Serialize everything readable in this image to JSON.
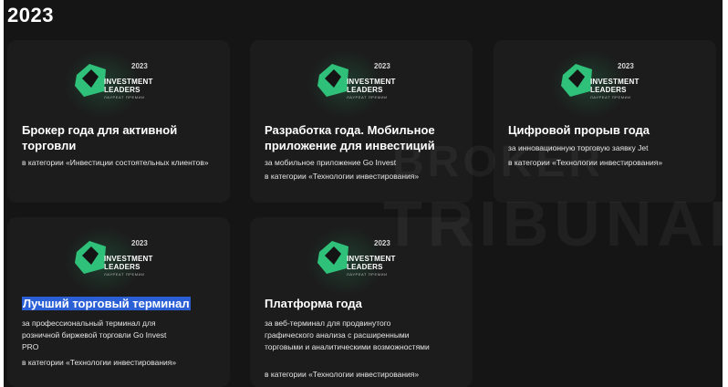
{
  "page": {
    "year_heading": "2023"
  },
  "watermark": {
    "line1": "BROKER",
    "line2": "TRIBUNAL"
  },
  "badge": {
    "year": "2023",
    "line1": "INVESTMENT",
    "line2": "LEADERS",
    "sub": "ЛАУРЕАТ ПРЕМИИ",
    "accent": "#2fc07a"
  },
  "awards": [
    {
      "title": "Брокер года для активной торговли",
      "desc1": "в категории «Инвестиции состоятельных клиентов»",
      "desc2": ""
    },
    {
      "title": "Разработка года. Мобильное приложение для инвестиций",
      "desc1": "за мобильное приложение Go Invest",
      "desc2": "в категории «Технологии инвестирования»"
    },
    {
      "title": "Цифровой прорыв года",
      "desc1": "за инновационную торговую заявку Jet",
      "desc2": "в категории «Технологии инвестирования»"
    },
    {
      "title": "Лучший торговый терминал",
      "desc1": "за профессиональный терминал для розничной биржевой торговли Go Invest PRO",
      "desc2": "в категории «Технологии инвестирования»"
    },
    {
      "title": "Платформа года",
      "desc1": "за веб-терминал для продвинутого графического анализа с расширенными торговыми и аналитическими возможностями",
      "desc2": "в категории «Технологии инвестирования»"
    }
  ]
}
